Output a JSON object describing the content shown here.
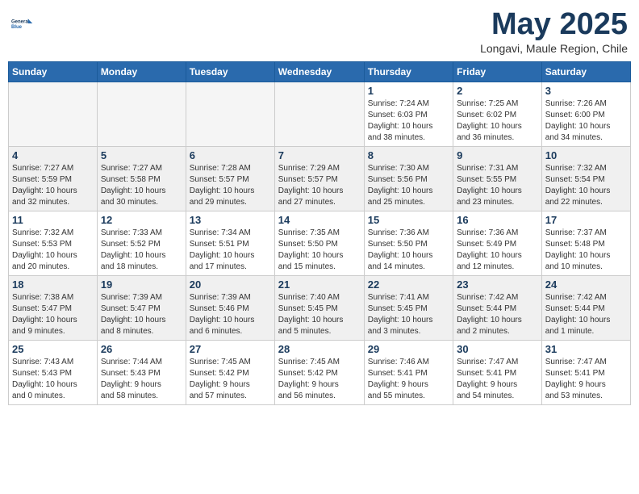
{
  "logo": {
    "name": "General",
    "name2": "Blue"
  },
  "title": "May 2025",
  "location": "Longavi, Maule Region, Chile",
  "days_of_week": [
    "Sunday",
    "Monday",
    "Tuesday",
    "Wednesday",
    "Thursday",
    "Friday",
    "Saturday"
  ],
  "weeks": [
    [
      {
        "day": "",
        "info": ""
      },
      {
        "day": "",
        "info": ""
      },
      {
        "day": "",
        "info": ""
      },
      {
        "day": "",
        "info": ""
      },
      {
        "day": "1",
        "info": "Sunrise: 7:24 AM\nSunset: 6:03 PM\nDaylight: 10 hours\nand 38 minutes."
      },
      {
        "day": "2",
        "info": "Sunrise: 7:25 AM\nSunset: 6:02 PM\nDaylight: 10 hours\nand 36 minutes."
      },
      {
        "day": "3",
        "info": "Sunrise: 7:26 AM\nSunset: 6:00 PM\nDaylight: 10 hours\nand 34 minutes."
      }
    ],
    [
      {
        "day": "4",
        "info": "Sunrise: 7:27 AM\nSunset: 5:59 PM\nDaylight: 10 hours\nand 32 minutes."
      },
      {
        "day": "5",
        "info": "Sunrise: 7:27 AM\nSunset: 5:58 PM\nDaylight: 10 hours\nand 30 minutes."
      },
      {
        "day": "6",
        "info": "Sunrise: 7:28 AM\nSunset: 5:57 PM\nDaylight: 10 hours\nand 29 minutes."
      },
      {
        "day": "7",
        "info": "Sunrise: 7:29 AM\nSunset: 5:57 PM\nDaylight: 10 hours\nand 27 minutes."
      },
      {
        "day": "8",
        "info": "Sunrise: 7:30 AM\nSunset: 5:56 PM\nDaylight: 10 hours\nand 25 minutes."
      },
      {
        "day": "9",
        "info": "Sunrise: 7:31 AM\nSunset: 5:55 PM\nDaylight: 10 hours\nand 23 minutes."
      },
      {
        "day": "10",
        "info": "Sunrise: 7:32 AM\nSunset: 5:54 PM\nDaylight: 10 hours\nand 22 minutes."
      }
    ],
    [
      {
        "day": "11",
        "info": "Sunrise: 7:32 AM\nSunset: 5:53 PM\nDaylight: 10 hours\nand 20 minutes."
      },
      {
        "day": "12",
        "info": "Sunrise: 7:33 AM\nSunset: 5:52 PM\nDaylight: 10 hours\nand 18 minutes."
      },
      {
        "day": "13",
        "info": "Sunrise: 7:34 AM\nSunset: 5:51 PM\nDaylight: 10 hours\nand 17 minutes."
      },
      {
        "day": "14",
        "info": "Sunrise: 7:35 AM\nSunset: 5:50 PM\nDaylight: 10 hours\nand 15 minutes."
      },
      {
        "day": "15",
        "info": "Sunrise: 7:36 AM\nSunset: 5:50 PM\nDaylight: 10 hours\nand 14 minutes."
      },
      {
        "day": "16",
        "info": "Sunrise: 7:36 AM\nSunset: 5:49 PM\nDaylight: 10 hours\nand 12 minutes."
      },
      {
        "day": "17",
        "info": "Sunrise: 7:37 AM\nSunset: 5:48 PM\nDaylight: 10 hours\nand 10 minutes."
      }
    ],
    [
      {
        "day": "18",
        "info": "Sunrise: 7:38 AM\nSunset: 5:47 PM\nDaylight: 10 hours\nand 9 minutes."
      },
      {
        "day": "19",
        "info": "Sunrise: 7:39 AM\nSunset: 5:47 PM\nDaylight: 10 hours\nand 8 minutes."
      },
      {
        "day": "20",
        "info": "Sunrise: 7:39 AM\nSunset: 5:46 PM\nDaylight: 10 hours\nand 6 minutes."
      },
      {
        "day": "21",
        "info": "Sunrise: 7:40 AM\nSunset: 5:45 PM\nDaylight: 10 hours\nand 5 minutes."
      },
      {
        "day": "22",
        "info": "Sunrise: 7:41 AM\nSunset: 5:45 PM\nDaylight: 10 hours\nand 3 minutes."
      },
      {
        "day": "23",
        "info": "Sunrise: 7:42 AM\nSunset: 5:44 PM\nDaylight: 10 hours\nand 2 minutes."
      },
      {
        "day": "24",
        "info": "Sunrise: 7:42 AM\nSunset: 5:44 PM\nDaylight: 10 hours\nand 1 minute."
      }
    ],
    [
      {
        "day": "25",
        "info": "Sunrise: 7:43 AM\nSunset: 5:43 PM\nDaylight: 10 hours\nand 0 minutes."
      },
      {
        "day": "26",
        "info": "Sunrise: 7:44 AM\nSunset: 5:43 PM\nDaylight: 9 hours\nand 58 minutes."
      },
      {
        "day": "27",
        "info": "Sunrise: 7:45 AM\nSunset: 5:42 PM\nDaylight: 9 hours\nand 57 minutes."
      },
      {
        "day": "28",
        "info": "Sunrise: 7:45 AM\nSunset: 5:42 PM\nDaylight: 9 hours\nand 56 minutes."
      },
      {
        "day": "29",
        "info": "Sunrise: 7:46 AM\nSunset: 5:41 PM\nDaylight: 9 hours\nand 55 minutes."
      },
      {
        "day": "30",
        "info": "Sunrise: 7:47 AM\nSunset: 5:41 PM\nDaylight: 9 hours\nand 54 minutes."
      },
      {
        "day": "31",
        "info": "Sunrise: 7:47 AM\nSunset: 5:41 PM\nDaylight: 9 hours\nand 53 minutes."
      }
    ]
  ]
}
